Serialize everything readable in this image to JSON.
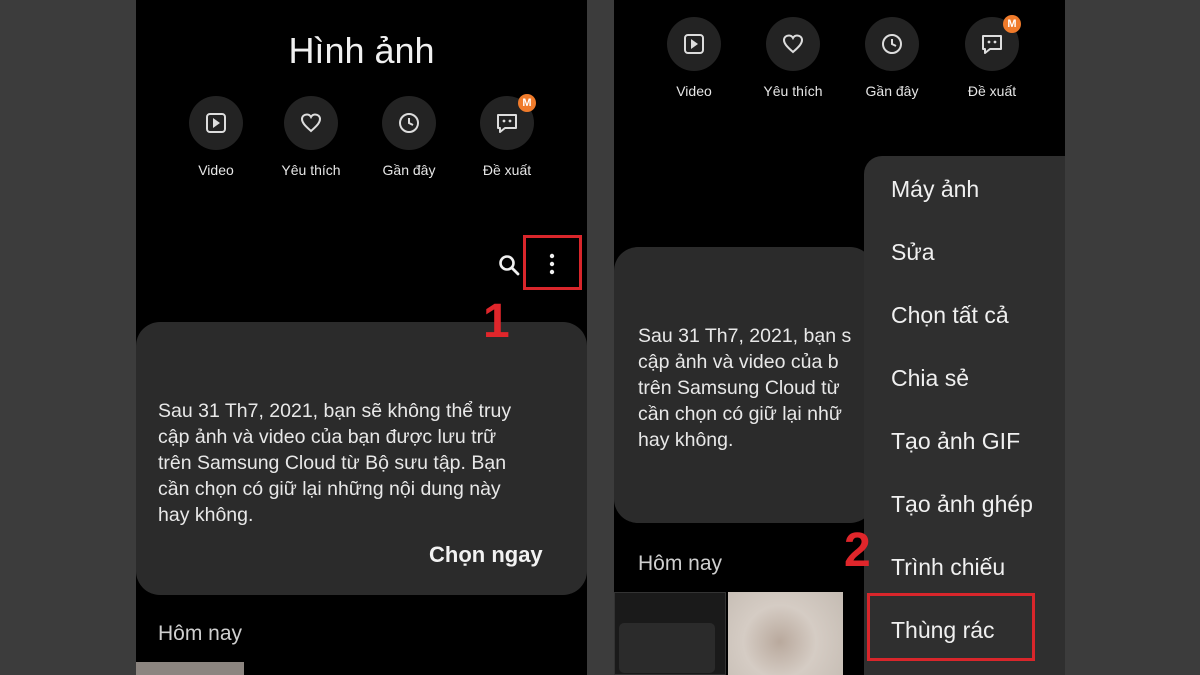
{
  "left": {
    "title": "Hình ảnh",
    "quick_actions": [
      {
        "label": "Video",
        "icon": "play-icon"
      },
      {
        "label": "Yêu thích",
        "icon": "heart-icon"
      },
      {
        "label": "Gần đây",
        "icon": "clock-icon"
      },
      {
        "label": "Đề xuất",
        "icon": "suggestion-icon",
        "badge": "M"
      }
    ],
    "card": {
      "lines": [
        "Sau 31 Th7, 2021, bạn sẽ không thể truy",
        "cập ảnh và video của bạn được lưu trữ",
        "trên Samsung Cloud từ Bộ sưu tập. Bạn",
        "cần chọn có giữ lại những nội dung này",
        "hay không."
      ],
      "action": "Chọn ngay"
    },
    "today": "Hôm nay"
  },
  "right": {
    "quick_actions": [
      {
        "label": "Video",
        "icon": "play-icon"
      },
      {
        "label": "Yêu thích",
        "icon": "heart-icon"
      },
      {
        "label": "Gần đây",
        "icon": "clock-icon"
      },
      {
        "label": "Đề xuất",
        "icon": "suggestion-icon",
        "badge": "M"
      }
    ],
    "card": {
      "lines": [
        "Sau 31 Th7, 2021, bạn s",
        "cập ảnh và video của b",
        "trên Samsung Cloud từ",
        "cần chọn có giữ lại nhữ",
        "hay không."
      ]
    },
    "today": "Hôm nay",
    "menu": [
      "Máy ảnh",
      "Sửa",
      "Chọn tất cả",
      "Chia sẻ",
      "Tạo ảnh GIF",
      "Tạo ảnh ghép",
      "Trình chiếu",
      "Thùng rác"
    ]
  },
  "annotations": {
    "step1": "1",
    "step2": "2"
  },
  "colors": {
    "highlight": "#d9262b",
    "badge": "#f07b2b",
    "card": "#2b2b2b",
    "menu": "#2f2f2f"
  }
}
